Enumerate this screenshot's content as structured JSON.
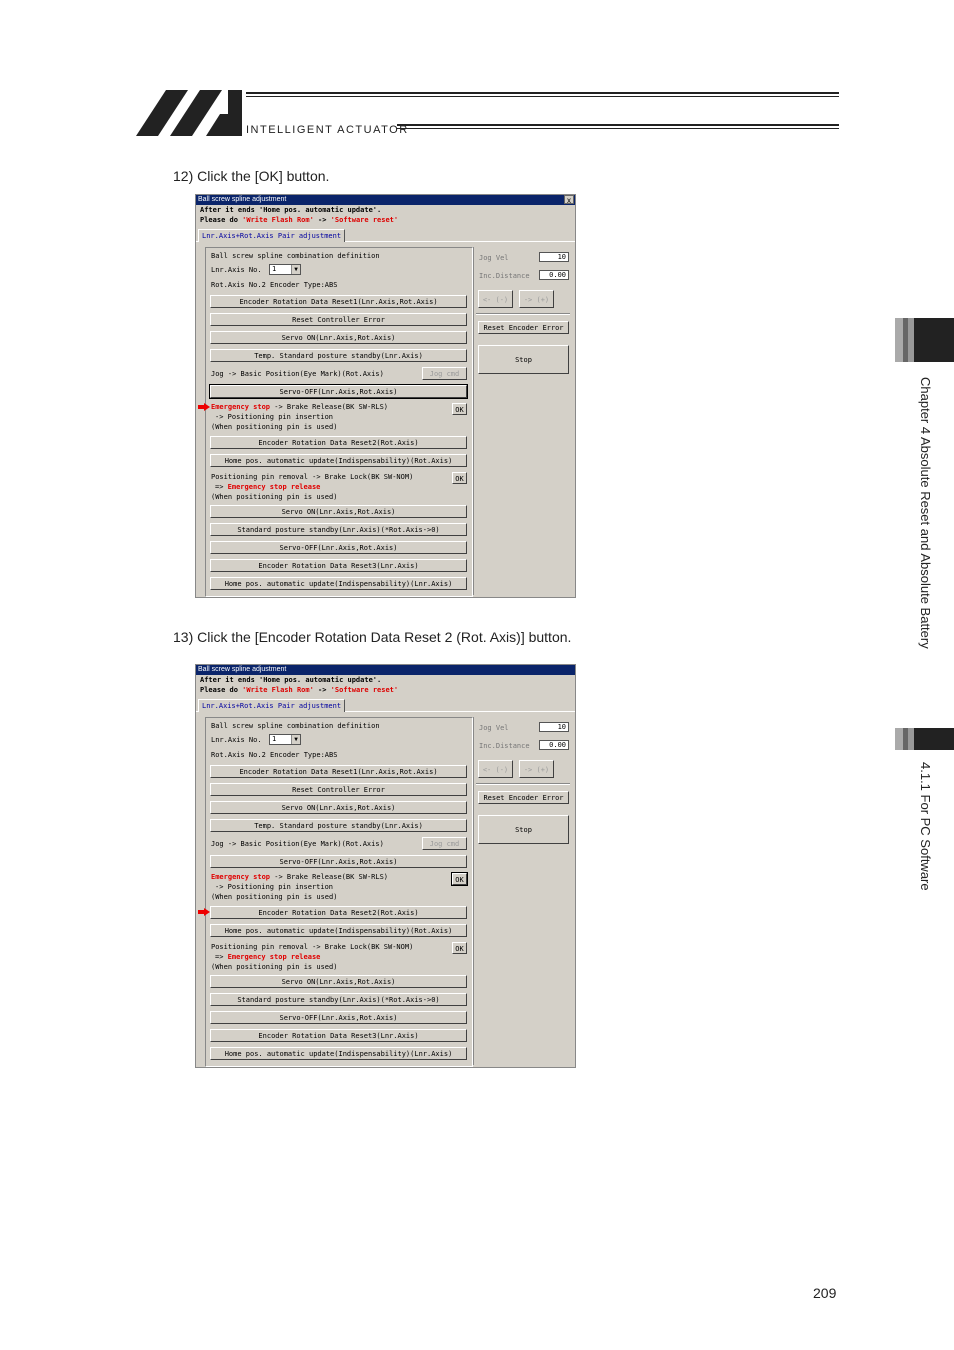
{
  "header": {
    "brand": "INTELLIGENT ACTUATOR"
  },
  "steps": [
    {
      "label": "12) Click the [OK] button."
    },
    {
      "label": "13) Click the [Encoder Rotation Data Reset 2 (Rot. Axis)] button."
    }
  ],
  "side": {
    "chapter": "Chapter 4 Absolute Reset and Absolute Battery",
    "section": "4.1.1 For PC Software"
  },
  "page_number": "209",
  "dialog": {
    "title": "Ball screw spline adjustment",
    "close": "x",
    "msg_line1": "After it ends 'Home pos. automatic update'.",
    "msg_line2_a": "Please do ",
    "msg_line2_b": "'Write Flash Rom'",
    "msg_line2_c": " -> ",
    "msg_line2_d": "'Software reset'",
    "tab": "Lnr.Axis+Rot.Axis Pair adjustment",
    "combo_title": "Ball screw spline combination definition",
    "lnr_axis_label": "Lnr.Axis No.",
    "lnr_axis_value": "1",
    "rot_axis_line": "Rot.Axis No.2   Encoder Type:ABS",
    "buttons": {
      "enc_reset1": "Encoder Rotation Data Reset1(Lnr.Axis,Rot.Axis)",
      "reset_ctrl_err": "Reset Controller Error",
      "servo_on_both": "Servo ON(Lnr.Axis,Rot.Axis)",
      "temp_standby": "Temp. Standard posture standby(Lnr.Axis)",
      "jog_cmd": "Jog cmd",
      "servo_off_1": "Servo-OFF(Lnr.Axis,Rot.Axis)",
      "ok": "OK",
      "enc_reset2": "Encoder Rotation Data Reset2(Rot.Axis)",
      "home_rot": "Home pos. automatic update(Indispensability)(Rot.Axis)",
      "servo_on_2": "Servo ON(Lnr.Axis,Rot.Axis)",
      "std_standby": "Standard posture standby(Lnr.Axis)(*Rot.Axis->0)",
      "servo_off_2": "Servo-OFF(Lnr.Axis,Rot.Axis)",
      "enc_reset3": "Encoder Rotation Data Reset3(Lnr.Axis)",
      "home_lnr": "Home pos. automatic update(Indispensability)(Lnr.Axis)",
      "jog_minus": "<- (-)",
      "jog_plus": "-> (+)",
      "reset_enc_err": "Reset Encoder Error",
      "stop": "Stop"
    },
    "jog_text": "Jog -> Basic Position(Eye Mark)(Rot.Axis)",
    "estop": "Emergency stop",
    "estop_tail": " -> Brake Release(BK SW-RLS)",
    "pin_insert": "-> Positioning pin insertion",
    "when_pin": "(When positioning pin is used)",
    "pin_remove": "Positioning pin removal -> Brake Lock(BK SW-NOM)",
    "arrow_prefix": "=> ",
    "estop_release": "Emergency stop release",
    "jog_vel_label": "Jog Vel",
    "jog_vel_value": "10",
    "inc_dist_label": "Inc.Distance",
    "inc_dist_value": "0.00"
  }
}
